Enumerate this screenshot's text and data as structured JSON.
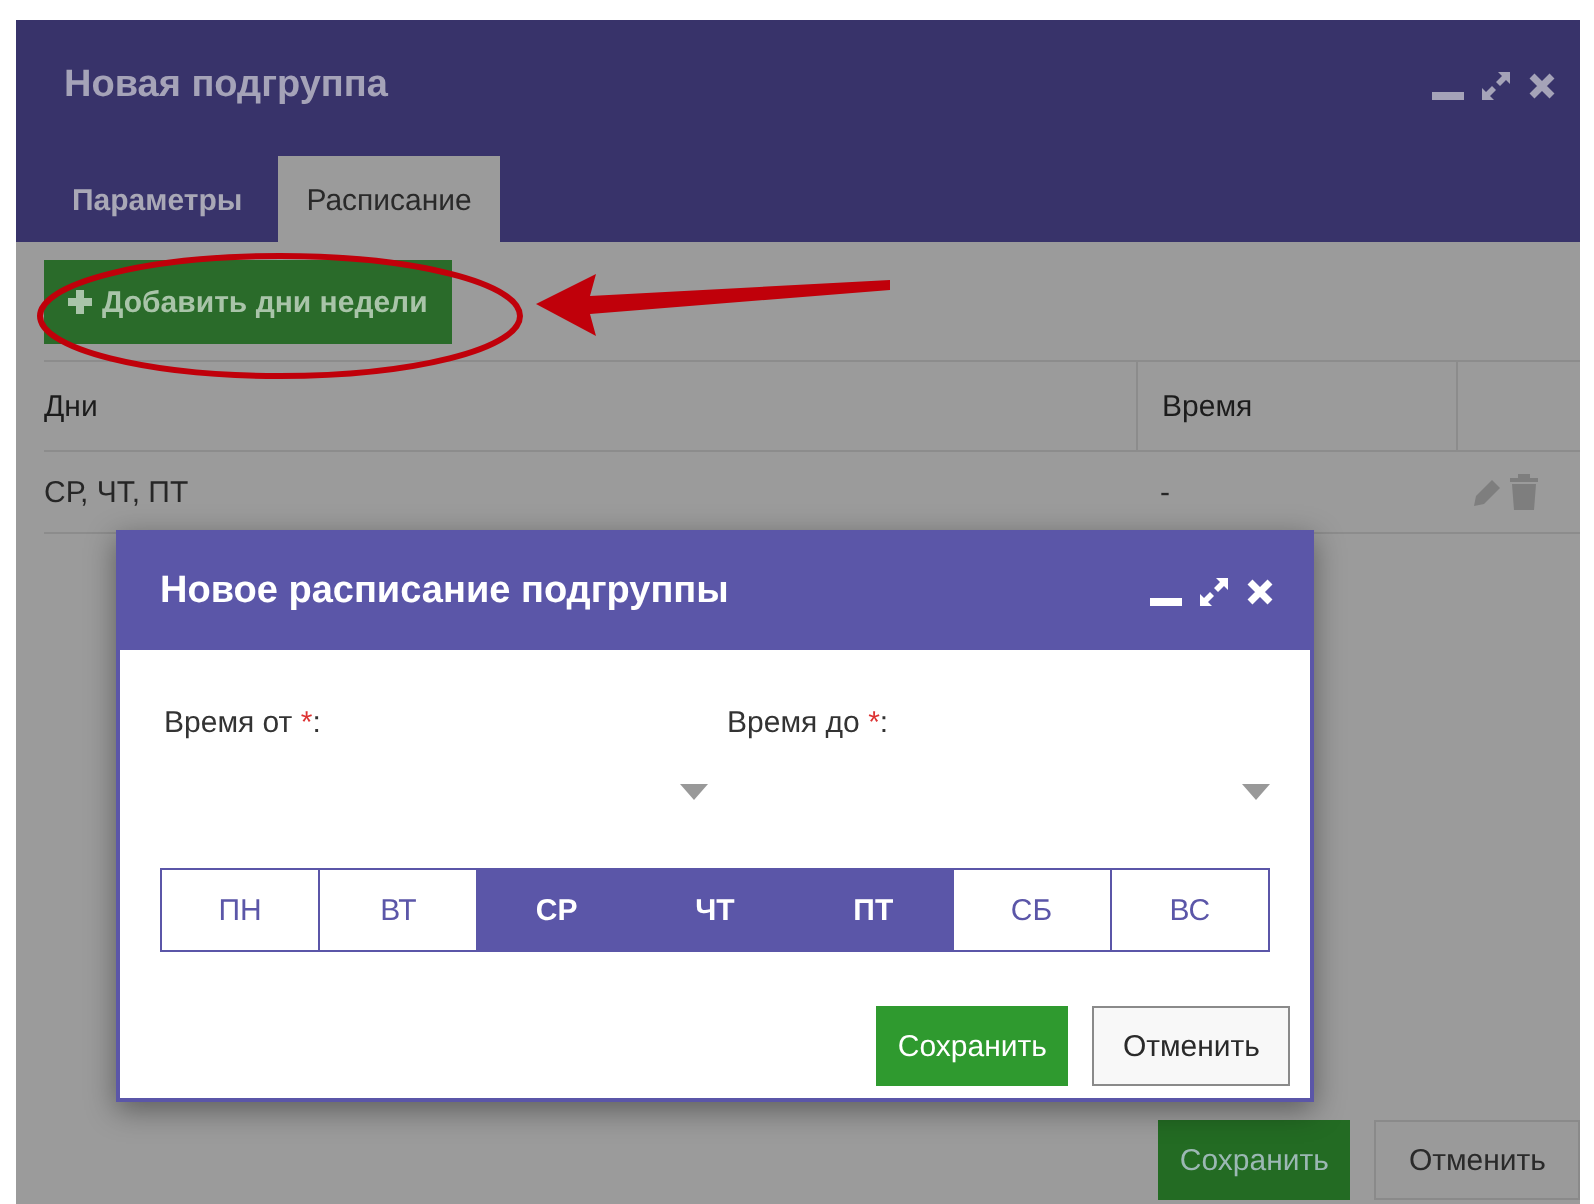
{
  "window": {
    "title": "Новая подгруппа"
  },
  "tabs": [
    {
      "label": "Параметры",
      "selected": false
    },
    {
      "label": "Расписание",
      "selected": true
    }
  ],
  "add_button": {
    "label": "Добавить дни недели"
  },
  "table": {
    "columns": [
      "Дни",
      "Время"
    ],
    "rows": [
      {
        "days": "СР, ЧТ, ПТ",
        "time": "-"
      }
    ]
  },
  "footer_buttons": [
    {
      "label": "Сохранить",
      "kind": "primary"
    },
    {
      "label": "Отменить",
      "kind": "secondary"
    }
  ],
  "dialog": {
    "title": "Новое расписание подгруппы",
    "fields": [
      {
        "label": "Время от",
        "required_mark": "*",
        "colon": ":"
      },
      {
        "label": "Время до",
        "required_mark": "*",
        "colon": ":"
      }
    ],
    "days": [
      {
        "label": "ПН",
        "selected": false
      },
      {
        "label": "ВТ",
        "selected": false
      },
      {
        "label": "СР",
        "selected": true
      },
      {
        "label": "ЧТ",
        "selected": true
      },
      {
        "label": "ПТ",
        "selected": true
      },
      {
        "label": "СБ",
        "selected": false
      },
      {
        "label": "ВС",
        "selected": false
      }
    ],
    "buttons": [
      {
        "label": "Сохранить",
        "kind": "primary"
      },
      {
        "label": "Отменить",
        "kind": "secondary"
      }
    ]
  }
}
